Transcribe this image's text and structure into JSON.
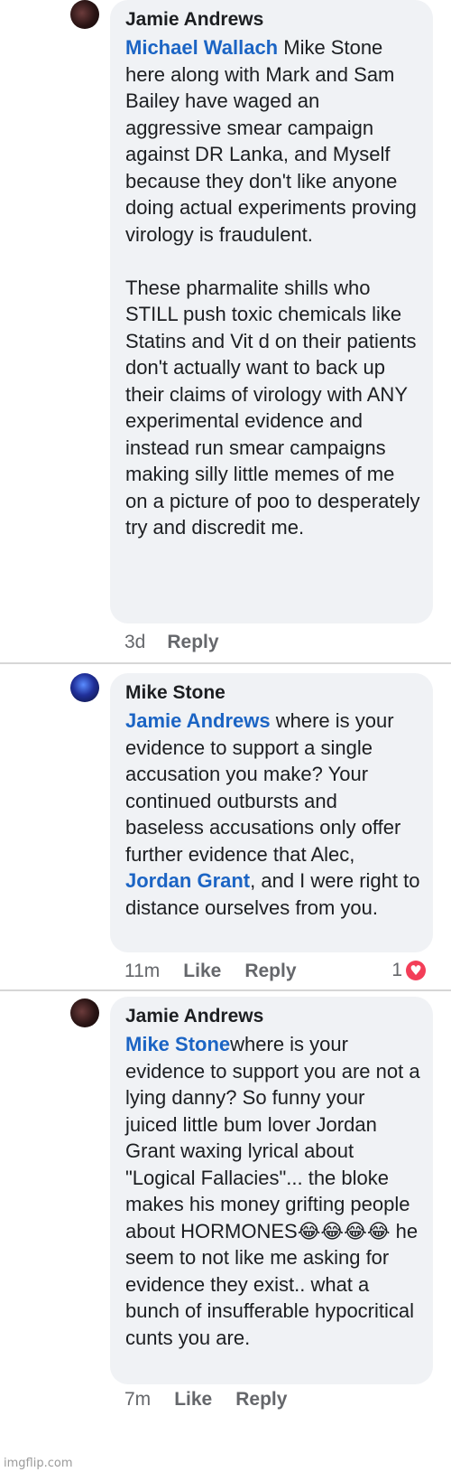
{
  "comments": [
    {
      "author": "Jamie Andrews",
      "mention": "Michael Wallach",
      "text": " Mike Stone here along with Mark and Sam Bailey have waged an aggressive smear campaign against DR Lanka, and Myself because they don't like anyone doing actual experiments proving virology is fraudulent.\n\nThese pharmalite shills who STILL push toxic chemicals like Statins and Vit d on their patients don't actually want to back up their claims of virology with ANY experimental evidence and instead run smear campaigns making silly little memes of me on a picture of poo to desperately try and discredit me.",
      "time": "3d",
      "reply_label": "Reply"
    },
    {
      "author": "Mike Stone",
      "mention": "Jamie Andrews",
      "text_before": " where is your evidence to support a single accusation you make? Your continued outbursts and baseless accusations only offer further evidence that Alec, ",
      "mention2": "Jordan Grant",
      "text_after": ", and I were right to distance ourselves from you.",
      "time": "11m",
      "like_label": "Like",
      "reply_label": "Reply",
      "reaction_count": "1",
      "reaction_icon": "heart-icon"
    },
    {
      "author": "Jamie Andrews",
      "mention": "Mike Stone",
      "text": "where is your evidence to support you are not a lying danny? So funny your juiced little bum lover Jordan Grant waxing lyrical about \"Logical Fallacies\"... the bloke makes his money grifting people about HORMONES😂😂😂😂 he seem to not like me asking for evidence they exist.. what a bunch of insufferable hypocritical cunts you are.",
      "time": "7m",
      "like_label": "Like",
      "reply_label": "Reply"
    }
  ],
  "watermark": "imgflip.com"
}
